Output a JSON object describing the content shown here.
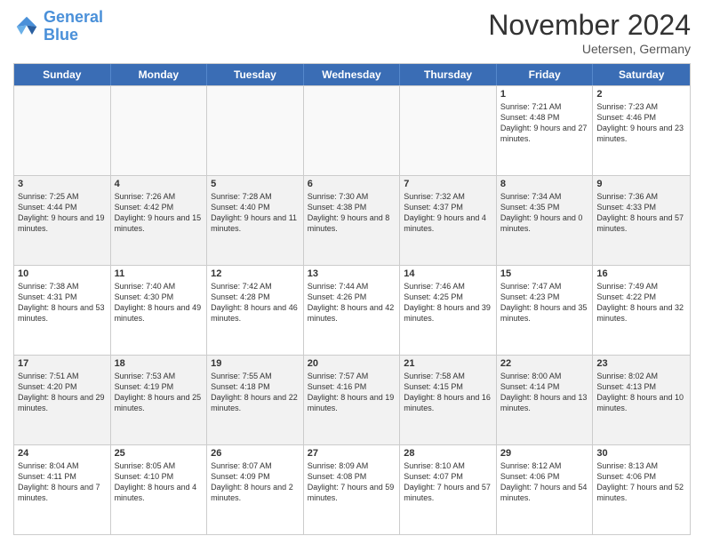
{
  "header": {
    "logo_line1": "General",
    "logo_line2": "Blue",
    "month_title": "November 2024",
    "location": "Uetersen, Germany"
  },
  "days_of_week": [
    "Sunday",
    "Monday",
    "Tuesday",
    "Wednesday",
    "Thursday",
    "Friday",
    "Saturday"
  ],
  "weeks": [
    [
      {
        "day": "",
        "empty": true
      },
      {
        "day": "",
        "empty": true
      },
      {
        "day": "",
        "empty": true
      },
      {
        "day": "",
        "empty": true
      },
      {
        "day": "",
        "empty": true
      },
      {
        "day": "1",
        "sunrise": "Sunrise: 7:21 AM",
        "sunset": "Sunset: 4:48 PM",
        "daylight": "Daylight: 9 hours and 27 minutes."
      },
      {
        "day": "2",
        "sunrise": "Sunrise: 7:23 AM",
        "sunset": "Sunset: 4:46 PM",
        "daylight": "Daylight: 9 hours and 23 minutes."
      }
    ],
    [
      {
        "day": "3",
        "sunrise": "Sunrise: 7:25 AM",
        "sunset": "Sunset: 4:44 PM",
        "daylight": "Daylight: 9 hours and 19 minutes."
      },
      {
        "day": "4",
        "sunrise": "Sunrise: 7:26 AM",
        "sunset": "Sunset: 4:42 PM",
        "daylight": "Daylight: 9 hours and 15 minutes."
      },
      {
        "day": "5",
        "sunrise": "Sunrise: 7:28 AM",
        "sunset": "Sunset: 4:40 PM",
        "daylight": "Daylight: 9 hours and 11 minutes."
      },
      {
        "day": "6",
        "sunrise": "Sunrise: 7:30 AM",
        "sunset": "Sunset: 4:38 PM",
        "daylight": "Daylight: 9 hours and 8 minutes."
      },
      {
        "day": "7",
        "sunrise": "Sunrise: 7:32 AM",
        "sunset": "Sunset: 4:37 PM",
        "daylight": "Daylight: 9 hours and 4 minutes."
      },
      {
        "day": "8",
        "sunrise": "Sunrise: 7:34 AM",
        "sunset": "Sunset: 4:35 PM",
        "daylight": "Daylight: 9 hours and 0 minutes."
      },
      {
        "day": "9",
        "sunrise": "Sunrise: 7:36 AM",
        "sunset": "Sunset: 4:33 PM",
        "daylight": "Daylight: 8 hours and 57 minutes."
      }
    ],
    [
      {
        "day": "10",
        "sunrise": "Sunrise: 7:38 AM",
        "sunset": "Sunset: 4:31 PM",
        "daylight": "Daylight: 8 hours and 53 minutes."
      },
      {
        "day": "11",
        "sunrise": "Sunrise: 7:40 AM",
        "sunset": "Sunset: 4:30 PM",
        "daylight": "Daylight: 8 hours and 49 minutes."
      },
      {
        "day": "12",
        "sunrise": "Sunrise: 7:42 AM",
        "sunset": "Sunset: 4:28 PM",
        "daylight": "Daylight: 8 hours and 46 minutes."
      },
      {
        "day": "13",
        "sunrise": "Sunrise: 7:44 AM",
        "sunset": "Sunset: 4:26 PM",
        "daylight": "Daylight: 8 hours and 42 minutes."
      },
      {
        "day": "14",
        "sunrise": "Sunrise: 7:46 AM",
        "sunset": "Sunset: 4:25 PM",
        "daylight": "Daylight: 8 hours and 39 minutes."
      },
      {
        "day": "15",
        "sunrise": "Sunrise: 7:47 AM",
        "sunset": "Sunset: 4:23 PM",
        "daylight": "Daylight: 8 hours and 35 minutes."
      },
      {
        "day": "16",
        "sunrise": "Sunrise: 7:49 AM",
        "sunset": "Sunset: 4:22 PM",
        "daylight": "Daylight: 8 hours and 32 minutes."
      }
    ],
    [
      {
        "day": "17",
        "sunrise": "Sunrise: 7:51 AM",
        "sunset": "Sunset: 4:20 PM",
        "daylight": "Daylight: 8 hours and 29 minutes."
      },
      {
        "day": "18",
        "sunrise": "Sunrise: 7:53 AM",
        "sunset": "Sunset: 4:19 PM",
        "daylight": "Daylight: 8 hours and 25 minutes."
      },
      {
        "day": "19",
        "sunrise": "Sunrise: 7:55 AM",
        "sunset": "Sunset: 4:18 PM",
        "daylight": "Daylight: 8 hours and 22 minutes."
      },
      {
        "day": "20",
        "sunrise": "Sunrise: 7:57 AM",
        "sunset": "Sunset: 4:16 PM",
        "daylight": "Daylight: 8 hours and 19 minutes."
      },
      {
        "day": "21",
        "sunrise": "Sunrise: 7:58 AM",
        "sunset": "Sunset: 4:15 PM",
        "daylight": "Daylight: 8 hours and 16 minutes."
      },
      {
        "day": "22",
        "sunrise": "Sunrise: 8:00 AM",
        "sunset": "Sunset: 4:14 PM",
        "daylight": "Daylight: 8 hours and 13 minutes."
      },
      {
        "day": "23",
        "sunrise": "Sunrise: 8:02 AM",
        "sunset": "Sunset: 4:13 PM",
        "daylight": "Daylight: 8 hours and 10 minutes."
      }
    ],
    [
      {
        "day": "24",
        "sunrise": "Sunrise: 8:04 AM",
        "sunset": "Sunset: 4:11 PM",
        "daylight": "Daylight: 8 hours and 7 minutes."
      },
      {
        "day": "25",
        "sunrise": "Sunrise: 8:05 AM",
        "sunset": "Sunset: 4:10 PM",
        "daylight": "Daylight: 8 hours and 4 minutes."
      },
      {
        "day": "26",
        "sunrise": "Sunrise: 8:07 AM",
        "sunset": "Sunset: 4:09 PM",
        "daylight": "Daylight: 8 hours and 2 minutes."
      },
      {
        "day": "27",
        "sunrise": "Sunrise: 8:09 AM",
        "sunset": "Sunset: 4:08 PM",
        "daylight": "Daylight: 7 hours and 59 minutes."
      },
      {
        "day": "28",
        "sunrise": "Sunrise: 8:10 AM",
        "sunset": "Sunset: 4:07 PM",
        "daylight": "Daylight: 7 hours and 57 minutes."
      },
      {
        "day": "29",
        "sunrise": "Sunrise: 8:12 AM",
        "sunset": "Sunset: 4:06 PM",
        "daylight": "Daylight: 7 hours and 54 minutes."
      },
      {
        "day": "30",
        "sunrise": "Sunrise: 8:13 AM",
        "sunset": "Sunset: 4:06 PM",
        "daylight": "Daylight: 7 hours and 52 minutes."
      }
    ]
  ]
}
